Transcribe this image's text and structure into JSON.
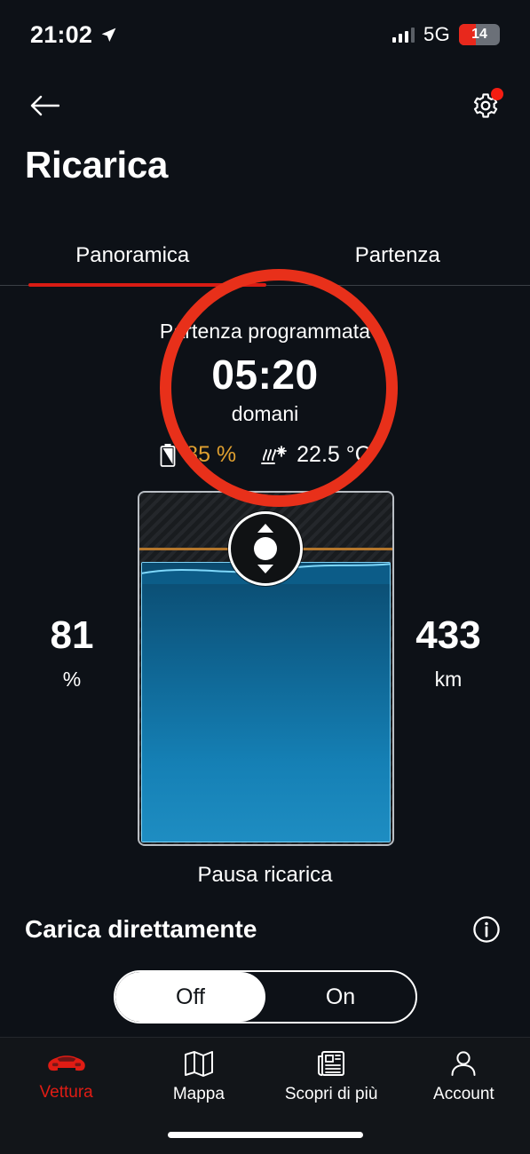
{
  "status_bar": {
    "time": "21:02",
    "location_icon": "location-arrow-icon",
    "signal_icon": "cellular-signal-icon",
    "network": "5G",
    "battery_level": "14",
    "battery_icon": "battery-low-icon"
  },
  "nav": {
    "back_icon": "arrow-left-icon",
    "settings_icon": "gear-icon",
    "has_notification_dot": true
  },
  "header": {
    "title": "Ricarica"
  },
  "tabs": [
    {
      "label": "Panoramica",
      "active": true
    },
    {
      "label": "Partenza",
      "active": false
    }
  ],
  "scheduled_departure": {
    "label": "Partenza programmata",
    "time": "05:20",
    "day": "domani",
    "charge_target": "85 %",
    "charge_target_icon": "battery-target-icon",
    "temperature": "22.5 °C",
    "temperature_icon": "climate-defrost-icon"
  },
  "battery_card": {
    "caption": "Pausa ricarica",
    "handle_icon": "drag-handle-up-down-icon",
    "current_level_percent": 81,
    "target_level_percent": 85
  },
  "readouts": {
    "left": {
      "value": "81",
      "unit": "%"
    },
    "right": {
      "value": "433",
      "unit": "km"
    }
  },
  "direct_charge": {
    "label": "Carica direttamente",
    "info_icon": "info-icon",
    "options": [
      {
        "label": "Off",
        "selected": true
      },
      {
        "label": "On",
        "selected": false
      }
    ]
  },
  "bottom_nav": [
    {
      "label": "Vettura",
      "icon": "car-icon",
      "active": true
    },
    {
      "label": "Mappa",
      "icon": "map-icon",
      "active": false
    },
    {
      "label": "Scopri di più",
      "icon": "news-icon",
      "active": false
    },
    {
      "label": "Account",
      "icon": "person-icon",
      "active": false
    }
  ],
  "annotation": {
    "shape": "circle",
    "color": "#e8301a"
  },
  "colors": {
    "background": "#0d1117",
    "accent_red": "#d81c14",
    "amber": "#e0a030",
    "battery_blue": "#1580b5",
    "annotation_red": "#e8301a"
  }
}
